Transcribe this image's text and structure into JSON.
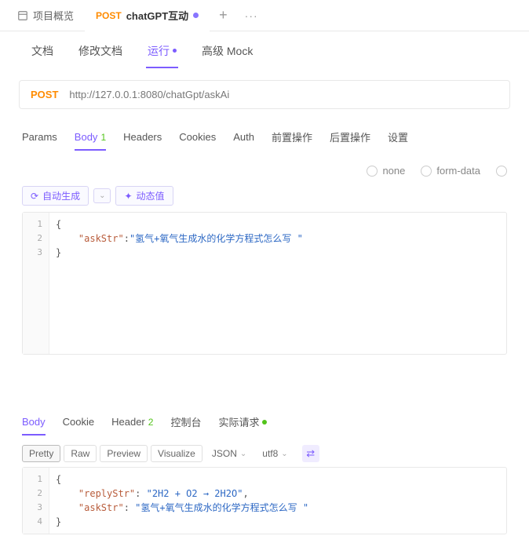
{
  "tabs": {
    "project_overview": "项目概览",
    "api": {
      "method": "POST",
      "name": "chatGPT互动"
    }
  },
  "sub_tabs": {
    "doc": "文档",
    "modify": "修改文档",
    "run": "运行",
    "mock": "高级 Mock"
  },
  "request": {
    "method": "POST",
    "url": "http://127.0.0.1:8080/chatGpt/askAi"
  },
  "req_tabs": {
    "params": "Params",
    "body": "Body",
    "body_count": "1",
    "headers": "Headers",
    "cookies": "Cookies",
    "auth": "Auth",
    "pre": "前置操作",
    "post": "后置操作",
    "settings": "设置"
  },
  "body_types": {
    "none": "none",
    "form_data": "form-data"
  },
  "actions": {
    "auto_gen": "自动生成",
    "dynamic": "动态值"
  },
  "req_body": {
    "lines": [
      "1",
      "2",
      "3"
    ],
    "open": "{",
    "key": "\"askStr\"",
    "colon": ":",
    "val": "\"氢气+氧气生成水的化学方程式怎么写 \"",
    "close": "}"
  },
  "resp_tabs": {
    "body": "Body",
    "cookie": "Cookie",
    "header": "Header",
    "header_count": "2",
    "console": "控制台",
    "actual": "实际请求"
  },
  "view_modes": {
    "pretty": "Pretty",
    "raw": "Raw",
    "preview": "Preview",
    "visualize": "Visualize",
    "format": "JSON",
    "encoding": "utf8"
  },
  "resp_body": {
    "lines": [
      "1",
      "2",
      "3",
      "4"
    ],
    "open": "{",
    "k1": "\"replyStr\"",
    "v1": "\"2H2 + O2 → 2H2O\"",
    "k2": "\"askStr\"",
    "v2": "\"氢气+氧气生成水的化学方程式怎么写 \"",
    "comma": ",",
    "colon": ": ",
    "close": "}"
  }
}
